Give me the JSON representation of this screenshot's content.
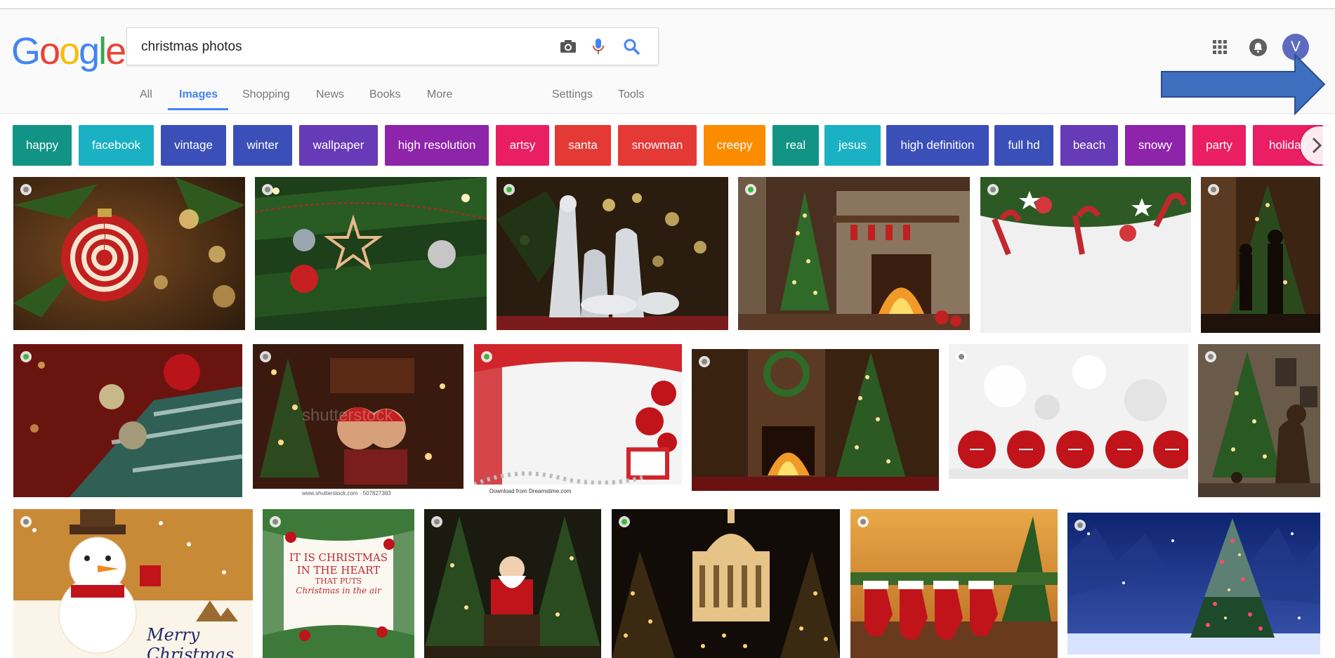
{
  "search": {
    "query": "christmas photos"
  },
  "logo": {
    "letters": [
      "G",
      "o",
      "o",
      "g",
      "l",
      "e"
    ]
  },
  "tabs": [
    {
      "label": "All",
      "active": false
    },
    {
      "label": "Images",
      "active": true
    },
    {
      "label": "Shopping",
      "active": false
    },
    {
      "label": "News",
      "active": false
    },
    {
      "label": "Books",
      "active": false
    },
    {
      "label": "More",
      "active": false
    },
    {
      "label": "Settings",
      "active": false
    },
    {
      "label": "Tools",
      "active": false
    }
  ],
  "account": {
    "initial": "V"
  },
  "chips": [
    {
      "label": "happy",
      "color": "#119486"
    },
    {
      "label": "facebook",
      "color": "#1bb1c4"
    },
    {
      "label": "vintage",
      "color": "#3b4fb8"
    },
    {
      "label": "winter",
      "color": "#3b4fb8"
    },
    {
      "label": "wallpaper",
      "color": "#673ab7"
    },
    {
      "label": "high resolution",
      "color": "#8e24aa"
    },
    {
      "label": "artsy",
      "color": "#e91e63"
    },
    {
      "label": "santa",
      "color": "#e53935"
    },
    {
      "label": "snowman",
      "color": "#e53935"
    },
    {
      "label": "creepy",
      "color": "#fb8c00"
    },
    {
      "label": "real",
      "color": "#119486"
    },
    {
      "label": "jesus",
      "color": "#1bb1c4"
    },
    {
      "label": "high definition",
      "color": "#3b4fb8"
    },
    {
      "label": "full hd",
      "color": "#3b4fb8"
    },
    {
      "label": "beach",
      "color": "#673ab7"
    },
    {
      "label": "snowy",
      "color": "#8e24aa"
    },
    {
      "label": "party",
      "color": "#e91e63"
    },
    {
      "label": "holiday",
      "color": "#e91e63"
    }
  ],
  "captions": {
    "shutterstock_watermark": "shutterstock",
    "shutterstock_id": "www.shutterstock.com · 507827383",
    "dreamstime_download": "Download from Dreamstime.com"
  },
  "artwork_text": {
    "snowman_card": "Merry Christmas",
    "heart_card_line1": "IT IS CHRISTMAS",
    "heart_card_line2": "IN THE HEART",
    "heart_card_line3": "THAT PUTS",
    "heart_card_line4": "Christmas in the air"
  },
  "colors": {
    "accent": "#4285f4",
    "arrow_fill": "#3f6fbf",
    "arrow_stroke": "#2a4f8f"
  }
}
